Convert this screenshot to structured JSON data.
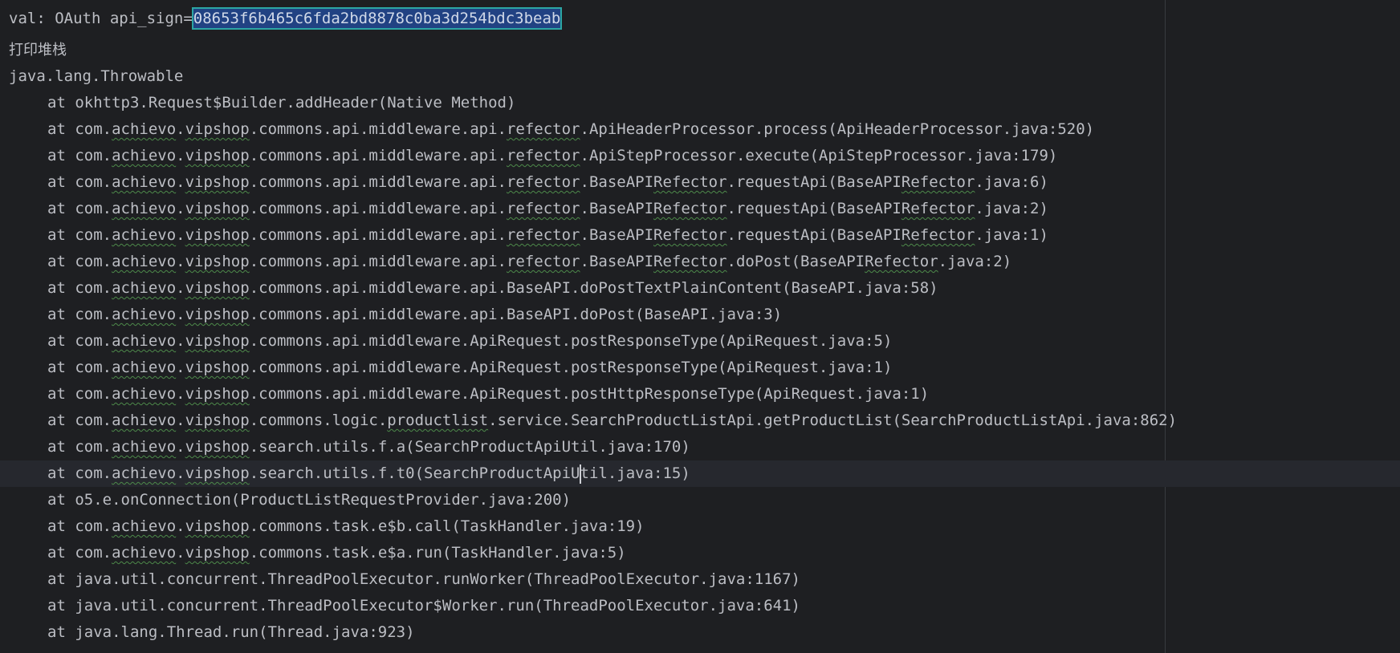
{
  "console": {
    "val_prefix": "val: OAuth api_sign=",
    "api_sign_selected": "08653f6b465c6fda2bd8878c0ba3d254bdc3beab",
    "print_stack_label": "打印堆栈",
    "exception_line": "java.lang.Throwable",
    "stack_lines": [
      {
        "segs": [
          {
            "t": "at okhttp3.Request$Builder.addHeader(Native Method)"
          }
        ]
      },
      {
        "segs": [
          {
            "t": "at com."
          },
          {
            "t": "achievo",
            "u": true
          },
          {
            "t": "."
          },
          {
            "t": "vipshop",
            "u": true
          },
          {
            "t": ".commons.api.middleware.api."
          },
          {
            "t": "refector",
            "u": true
          },
          {
            "t": ".ApiHeaderProcessor.process(ApiHeaderProcessor.java:520)"
          }
        ]
      },
      {
        "segs": [
          {
            "t": "at com."
          },
          {
            "t": "achievo",
            "u": true
          },
          {
            "t": "."
          },
          {
            "t": "vipshop",
            "u": true
          },
          {
            "t": ".commons.api.middleware.api."
          },
          {
            "t": "refector",
            "u": true
          },
          {
            "t": ".ApiStepProcessor.execute(ApiStepProcessor.java:179)"
          }
        ]
      },
      {
        "segs": [
          {
            "t": "at com."
          },
          {
            "t": "achievo",
            "u": true
          },
          {
            "t": "."
          },
          {
            "t": "vipshop",
            "u": true
          },
          {
            "t": ".commons.api.middleware.api."
          },
          {
            "t": "refector",
            "u": true
          },
          {
            "t": ".BaseAPI"
          },
          {
            "t": "Refector",
            "u": true
          },
          {
            "t": ".requestApi(BaseAPI"
          },
          {
            "t": "Refector",
            "u": true
          },
          {
            "t": ".java:6)"
          }
        ]
      },
      {
        "segs": [
          {
            "t": "at com."
          },
          {
            "t": "achievo",
            "u": true
          },
          {
            "t": "."
          },
          {
            "t": "vipshop",
            "u": true
          },
          {
            "t": ".commons.api.middleware.api."
          },
          {
            "t": "refector",
            "u": true
          },
          {
            "t": ".BaseAPI"
          },
          {
            "t": "Refector",
            "u": true
          },
          {
            "t": ".requestApi(BaseAPI"
          },
          {
            "t": "Refector",
            "u": true
          },
          {
            "t": ".java:2)"
          }
        ]
      },
      {
        "segs": [
          {
            "t": "at com."
          },
          {
            "t": "achievo",
            "u": true
          },
          {
            "t": "."
          },
          {
            "t": "vipshop",
            "u": true
          },
          {
            "t": ".commons.api.middleware.api."
          },
          {
            "t": "refector",
            "u": true
          },
          {
            "t": ".BaseAPI"
          },
          {
            "t": "Refector",
            "u": true
          },
          {
            "t": ".requestApi(BaseAPI"
          },
          {
            "t": "Refector",
            "u": true
          },
          {
            "t": ".java:1)"
          }
        ]
      },
      {
        "segs": [
          {
            "t": "at com."
          },
          {
            "t": "achievo",
            "u": true
          },
          {
            "t": "."
          },
          {
            "t": "vipshop",
            "u": true
          },
          {
            "t": ".commons.api.middleware.api."
          },
          {
            "t": "refector",
            "u": true
          },
          {
            "t": ".BaseAPI"
          },
          {
            "t": "Refector",
            "u": true
          },
          {
            "t": ".doPost(BaseAPI"
          },
          {
            "t": "Refector",
            "u": true
          },
          {
            "t": ".java:2)"
          }
        ]
      },
      {
        "segs": [
          {
            "t": "at com."
          },
          {
            "t": "achievo",
            "u": true
          },
          {
            "t": "."
          },
          {
            "t": "vipshop",
            "u": true
          },
          {
            "t": ".commons.api.middleware.api.BaseAPI.doPostTextPlainContent(BaseAPI.java:58)"
          }
        ]
      },
      {
        "segs": [
          {
            "t": "at com."
          },
          {
            "t": "achievo",
            "u": true
          },
          {
            "t": "."
          },
          {
            "t": "vipshop",
            "u": true
          },
          {
            "t": ".commons.api.middleware.api.BaseAPI.doPost(BaseAPI.java:3)"
          }
        ]
      },
      {
        "segs": [
          {
            "t": "at com."
          },
          {
            "t": "achievo",
            "u": true
          },
          {
            "t": "."
          },
          {
            "t": "vipshop",
            "u": true
          },
          {
            "t": ".commons.api.middleware.ApiRequest.postResponseType(ApiRequest.java:5)"
          }
        ]
      },
      {
        "segs": [
          {
            "t": "at com."
          },
          {
            "t": "achievo",
            "u": true
          },
          {
            "t": "."
          },
          {
            "t": "vipshop",
            "u": true
          },
          {
            "t": ".commons.api.middleware.ApiRequest.postResponseType(ApiRequest.java:1)"
          }
        ]
      },
      {
        "segs": [
          {
            "t": "at com."
          },
          {
            "t": "achievo",
            "u": true
          },
          {
            "t": "."
          },
          {
            "t": "vipshop",
            "u": true
          },
          {
            "t": ".commons.api.middleware.ApiRequest.postHttpResponseType(ApiRequest.java:1)"
          }
        ]
      },
      {
        "segs": [
          {
            "t": "at com."
          },
          {
            "t": "achievo",
            "u": true
          },
          {
            "t": "."
          },
          {
            "t": "vipshop",
            "u": true
          },
          {
            "t": ".commons.logic."
          },
          {
            "t": "productlist",
            "u": true
          },
          {
            "t": ".service.SearchProductListApi.getProductList(SearchProductListApi.java:862)"
          }
        ]
      },
      {
        "segs": [
          {
            "t": "at com."
          },
          {
            "t": "achievo",
            "u": true
          },
          {
            "t": "."
          },
          {
            "t": "vipshop",
            "u": true
          },
          {
            "t": ".search.utils.f.a(SearchProductApiUtil.java:170)"
          }
        ]
      },
      {
        "current": true,
        "segs": [
          {
            "t": "at com."
          },
          {
            "t": "achievo",
            "u": true
          },
          {
            "t": "."
          },
          {
            "t": "vipshop",
            "u": true
          },
          {
            "t": ".search.utils.f.t0(SearchProductApiU"
          },
          {
            "caret": true
          },
          {
            "t": "til.java:15)"
          }
        ]
      },
      {
        "segs": [
          {
            "t": "at o5.e.onConnection(ProductListRequestProvider.java:200)"
          }
        ]
      },
      {
        "segs": [
          {
            "t": "at com."
          },
          {
            "t": "achievo",
            "u": true
          },
          {
            "t": "."
          },
          {
            "t": "vipshop",
            "u": true
          },
          {
            "t": ".commons.task.e$b.call(TaskHandler.java:19)"
          }
        ]
      },
      {
        "segs": [
          {
            "t": "at com."
          },
          {
            "t": "achievo",
            "u": true
          },
          {
            "t": "."
          },
          {
            "t": "vipshop",
            "u": true
          },
          {
            "t": ".commons.task.e$a.run(TaskHandler.java:5)"
          }
        ]
      },
      {
        "segs": [
          {
            "t": "at java.util.concurrent.ThreadPoolExecutor.runWorker(ThreadPoolExecutor.java:1167)"
          }
        ]
      },
      {
        "segs": [
          {
            "t": "at java.util.concurrent.ThreadPoolExecutor$Worker.run(ThreadPoolExecutor.java:641)"
          }
        ]
      },
      {
        "segs": [
          {
            "t": "at java.lang.Thread.run(Thread.java:923)"
          }
        ]
      }
    ]
  },
  "colors": {
    "background": "#1e1f22",
    "text": "#bcbec4",
    "selection": "#214283",
    "selection_border": "#2ca6a4",
    "typo_underline": "#4d8a4a",
    "current_line": "#26282e"
  }
}
